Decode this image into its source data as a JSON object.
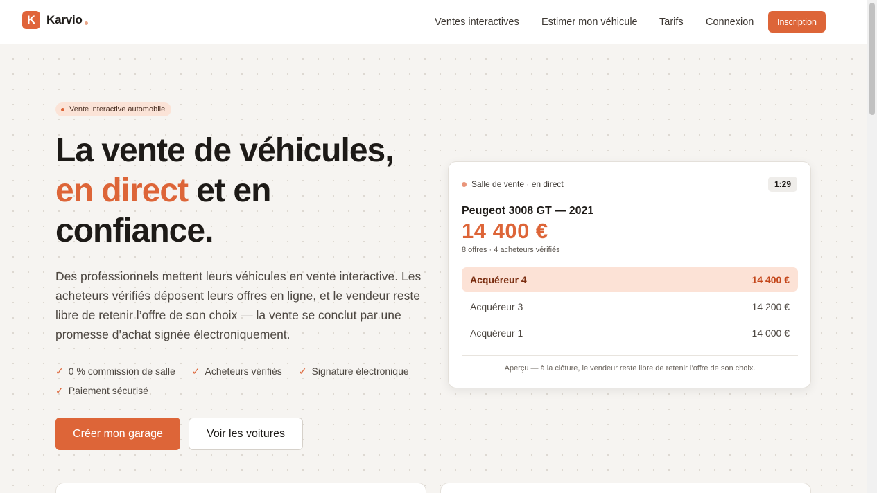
{
  "header": {
    "logo_letter": "K",
    "brand": "Karvio",
    "nav": [
      "Ventes interactives",
      "Estimer mon véhicule",
      "Tarifs",
      "Connexion"
    ],
    "signup": "Inscription"
  },
  "hero": {
    "badge": "Vente interactive automobile",
    "title_line1": "La vente de véhicules,",
    "title_accent": "en direct",
    "title_line2_rest": " et en",
    "title_line3": "confiance.",
    "description": "Des professionnels mettent leurs véhicules en vente interactive. Les acheteurs vérifiés déposent leurs offres en ligne, et le vendeur reste libre de retenir l’offre de son choix — la vente se conclut par une promesse d’achat signée électroniquement.",
    "features": [
      "0 % commission de salle",
      "Acheteurs vérifiés",
      "Signature électronique",
      "Paiement sécurisé"
    ],
    "cta_primary": "Créer mon garage",
    "cta_secondary": "Voir les voitures"
  },
  "auction": {
    "status": "Salle de vente · en direct",
    "timer": "1:29",
    "car": "Peugeot 3008 GT — 2021",
    "price": "14 400 €",
    "meta": "8 offres · 4 acheteurs vérifiés",
    "bids": [
      {
        "buyer": "Acquéreur 4",
        "amount": "14 400 €"
      },
      {
        "buyer": "Acquéreur 3",
        "amount": "14 200 €"
      },
      {
        "buyer": "Acquéreur 1",
        "amount": "14 000 €"
      }
    ],
    "footnote": "Aperçu — à la clôture, le vendeur reste libre de retenir l’offre de son choix."
  },
  "colors": {
    "accent": "#dd6538",
    "accent_soft": "#fce2d6",
    "background": "#f6f4f1"
  }
}
